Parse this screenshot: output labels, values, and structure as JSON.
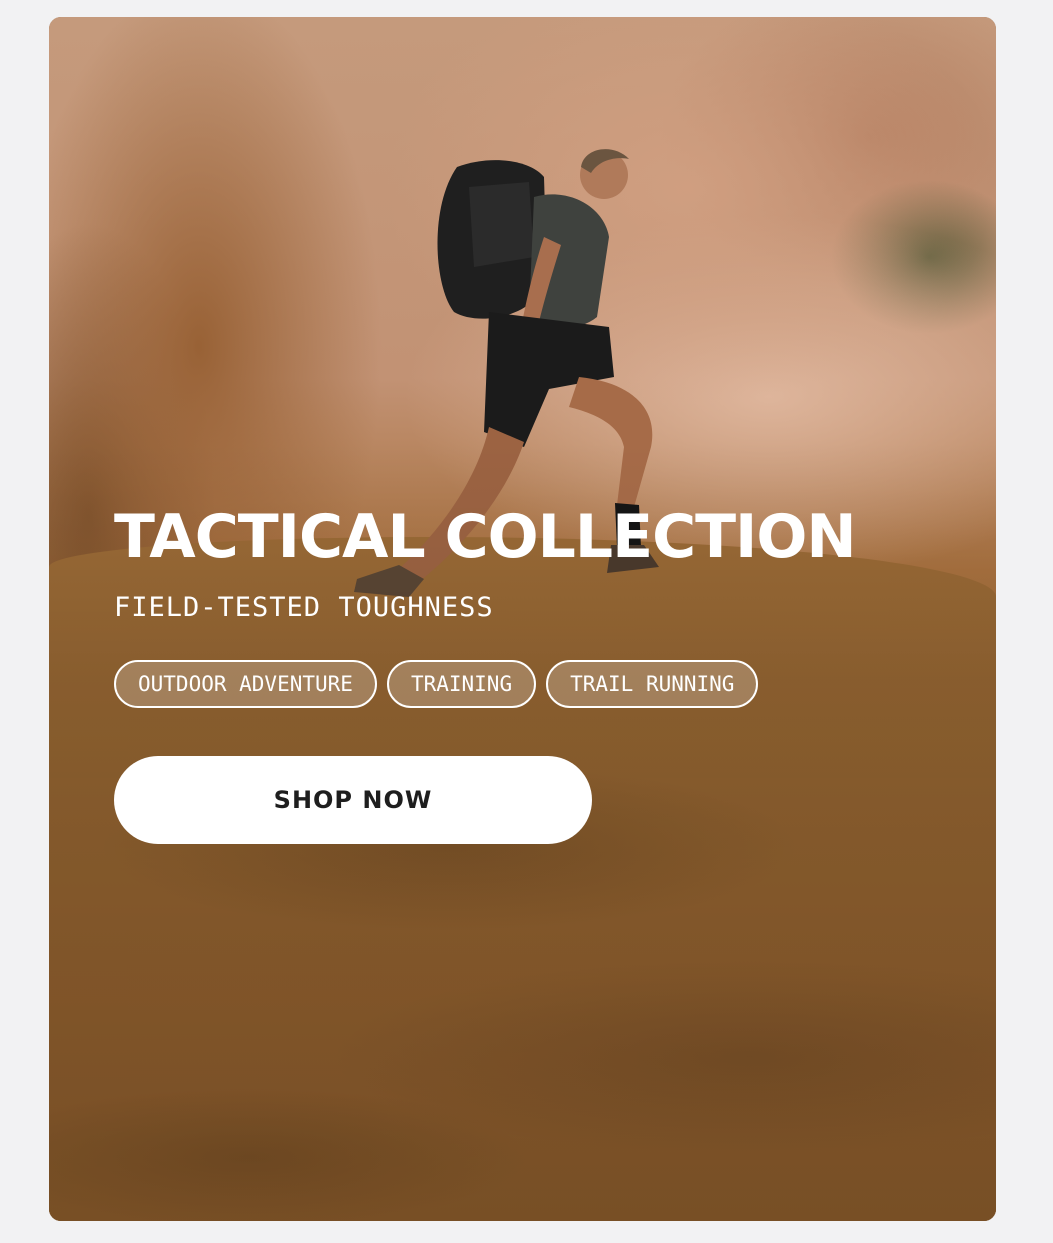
{
  "hero": {
    "title": "TACTICAL COLLECTION",
    "subtitle": "FIELD-TESTED TOUGHNESS",
    "tags": [
      "OUTDOOR ADVENTURE",
      "TRAINING",
      "TRAIL RUNNING"
    ],
    "cta_label": "SHOP NOW"
  },
  "colors": {
    "page_background": "#f2f2f3",
    "button_background": "#ffffff",
    "button_text": "#1e1e1e",
    "text_on_image": "#ffffff"
  }
}
